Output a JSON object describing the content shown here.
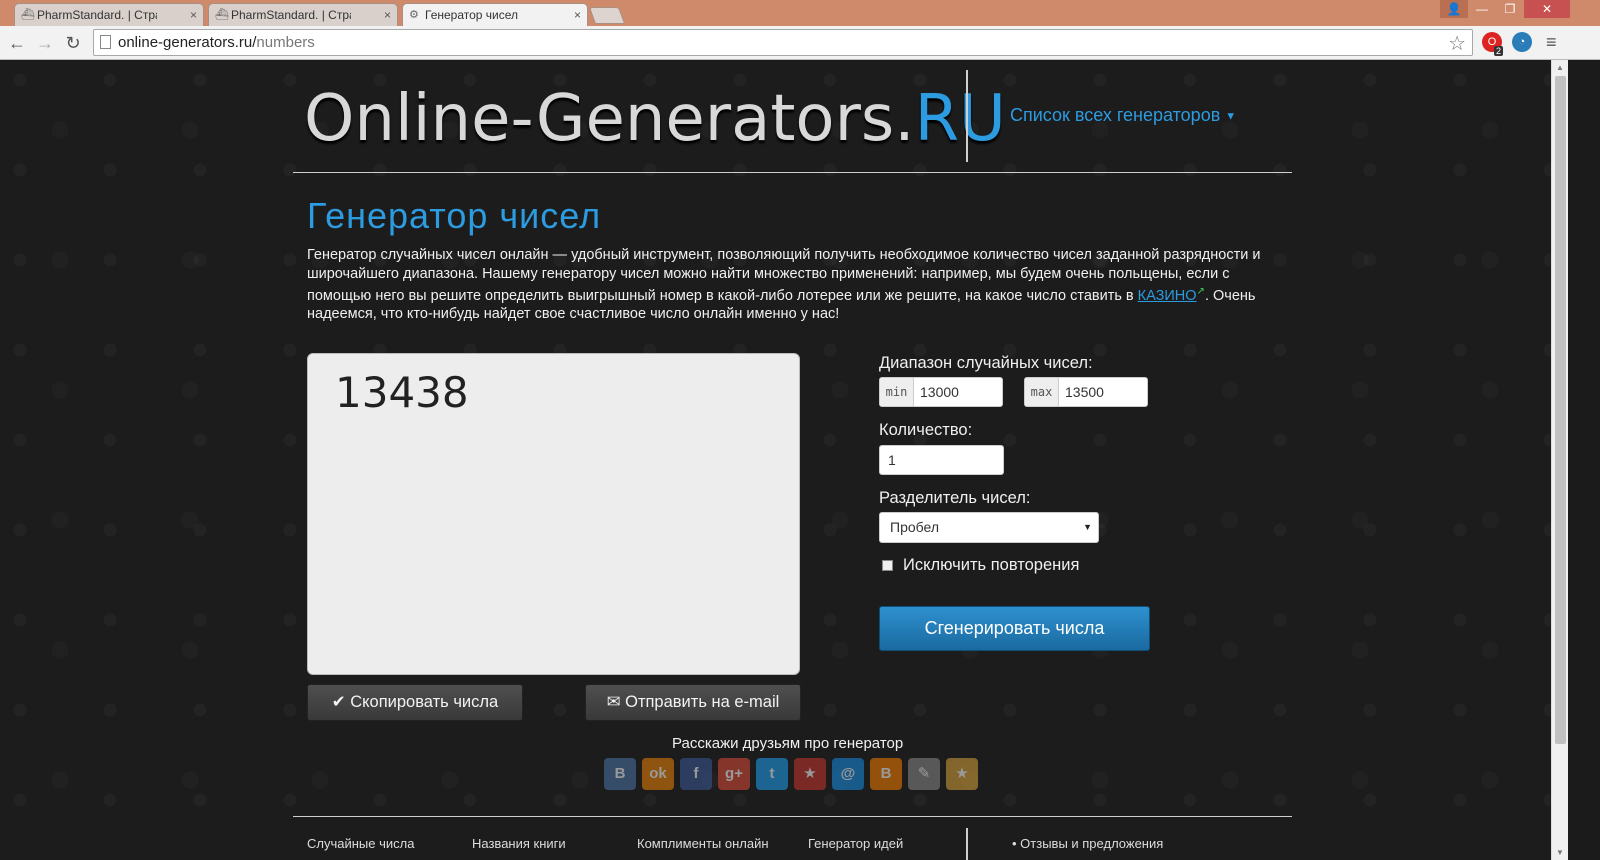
{
  "browser": {
    "tabs": [
      {
        "title": "PharmStandard. | Страниц",
        "active": false
      },
      {
        "title": "PharmStandard. | Страниц",
        "active": false
      },
      {
        "title": "Генератор чисел",
        "active": true
      }
    ],
    "tab_close_glyph": "×",
    "url_host": "online-generators.ru/",
    "url_path": "numbers",
    "opera_badge": "2"
  },
  "header": {
    "logo_main": "Online-Generators.",
    "logo_accent": "RU",
    "generators_link": "Список всех генераторов"
  },
  "main": {
    "title": "Генератор чисел",
    "intro_text": "Генератор случайных чисел онлайн — удобный инструмент, позволяющий получить необходимое количество чисел заданной разрядности и широчайшего диапазона. Нашему генератору чисел можно найти множество применений: например, мы будем очень польщены, если с помощью него вы решите определить выигрышный номер в какой-либо лотерее или же решите, на какое число ставить в ",
    "intro_link": "КАЗИНО",
    "intro_tail": ". Очень надеемся, что кто-нибудь найдет свое счастливое число онлайн именно у нас!",
    "result": "13438",
    "copy_button": "Скопировать числа",
    "email_button": "Отправить на e-mail",
    "share_title": "Расскажи друзьям про генератор"
  },
  "share_icons": [
    {
      "name": "vk-icon",
      "glyph": "B",
      "color": "#4a76a8"
    },
    {
      "name": "odnoklassniki-icon",
      "glyph": "ok",
      "color": "#ee8208"
    },
    {
      "name": "facebook-icon",
      "glyph": "f",
      "color": "#3b5998"
    },
    {
      "name": "google-plus-icon",
      "glyph": "g+",
      "color": "#dd4b39"
    },
    {
      "name": "twitter-icon",
      "glyph": "t",
      "color": "#1da1f2"
    },
    {
      "name": "moimir-icon",
      "glyph": "★",
      "color": "#c8342b"
    },
    {
      "name": "mailru-icon",
      "glyph": "@",
      "color": "#168de2"
    },
    {
      "name": "blogger-icon",
      "glyph": "B",
      "color": "#f57d00"
    },
    {
      "name": "livejournal-icon",
      "glyph": "✎",
      "color": "#8a8a8a"
    },
    {
      "name": "favorites-icon",
      "glyph": "★",
      "color": "#d7a33a"
    }
  ],
  "form": {
    "range_label": "Диапазон случайных чисел:",
    "min_addon": "min",
    "min_value": "13000",
    "max_addon": "max",
    "max_value": "13500",
    "count_label": "Количество:",
    "count_value": "1",
    "separator_label": "Разделитель чисел:",
    "separator_value": "Пробел",
    "dedupe_label": "Исключить повторения",
    "generate_button": "Сгенерировать числа"
  },
  "footer": {
    "links": [
      "Случайные числа",
      "Названия книги",
      "Комплименты онлайн",
      "Генератор идей",
      "• Отзывы и предложения"
    ]
  },
  "colors": {
    "accent": "#2c9be0",
    "page_bg": "#1c1c1c",
    "tabbar": "#cf8a6c"
  }
}
